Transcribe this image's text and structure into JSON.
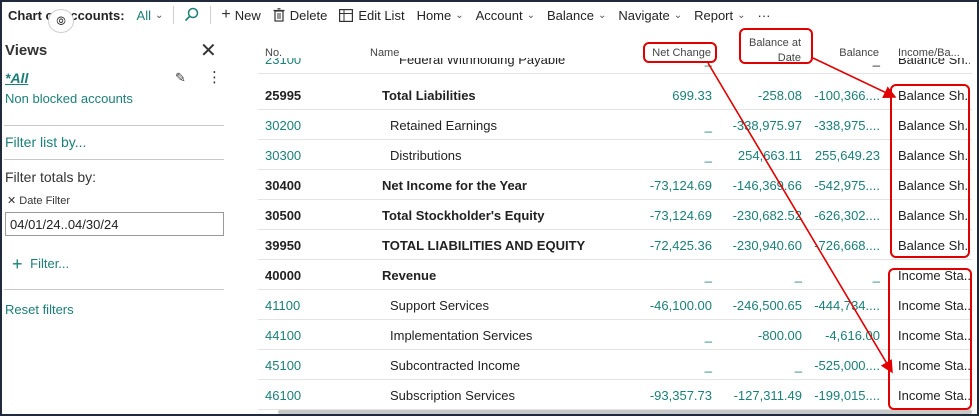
{
  "toolbar": {
    "title": "Chart of Accounts:",
    "filter": "All",
    "new": "New",
    "delete": "Delete",
    "edit_list": "Edit List",
    "home": "Home",
    "account": "Account",
    "balance": "Balance",
    "navigate": "Navigate",
    "report": "Report",
    "more": "···"
  },
  "views": {
    "title": "Views",
    "all": "*All",
    "blocked": "Non blocked accounts",
    "filter_list": "Filter list by...",
    "filter_totals": "Filter totals by:",
    "date_filter_label": "Date Filter",
    "date_filter_value": "04/01/24..04/30/24",
    "add_filter": "Filter...",
    "reset": "Reset filters"
  },
  "grid": {
    "columns": {
      "no": "No.",
      "name": "Name",
      "net_change": "Net Change",
      "balance_at_date_1": "Balance at",
      "balance_at_date_2": "Date",
      "balance": "Balance",
      "income_balance": "Income/Ba..."
    },
    "partial_row": {
      "no": "23100",
      "name": "Federal Withholding Payable",
      "net_change": "_",
      "balance_at_date": "",
      "balance": "_",
      "income_balance": "Balance Sh..."
    },
    "rows": [
      {
        "no": "25995",
        "name": "Total Liabilities",
        "net_change": "699.33",
        "balance_at_date": "-258.08",
        "balance": "-100,366....",
        "income_balance": "Balance Sh..."
      },
      {
        "no": "30200",
        "name": "Retained Earnings",
        "net_change": "_",
        "balance_at_date": "-338,975.97",
        "balance": "-338,975....",
        "income_balance": "Balance Sh..."
      },
      {
        "no": "30300",
        "name": "Distributions",
        "net_change": "_",
        "balance_at_date": "254,663.11",
        "balance": "255,649.23",
        "income_balance": "Balance Sh..."
      },
      {
        "no": "30400",
        "name": "Net Income for the Year",
        "net_change": "-73,124.69",
        "balance_at_date": "-146,369.66",
        "balance": "-542,975....",
        "income_balance": "Balance Sh..."
      },
      {
        "no": "30500",
        "name": "Total Stockholder's Equity",
        "net_change": "-73,124.69",
        "balance_at_date": "-230,682.52",
        "balance": "-626,302....",
        "income_balance": "Balance Sh..."
      },
      {
        "no": "39950",
        "name": "TOTAL LIABILITIES AND EQUITY",
        "net_change": "-72,425.36",
        "balance_at_date": "-230,940.60",
        "balance": "-726,668....",
        "income_balance": "Balance Sh..."
      },
      {
        "no": "40000",
        "name": "Revenue",
        "net_change": "_",
        "balance_at_date": "_",
        "balance": "_",
        "income_balance": "Income Sta..."
      },
      {
        "no": "41100",
        "name": "Support Services",
        "net_change": "-46,100.00",
        "balance_at_date": "-246,500.65",
        "balance": "-444,734....",
        "income_balance": "Income Sta..."
      },
      {
        "no": "44100",
        "name": "Implementation Services",
        "net_change": "_",
        "balance_at_date": "-800.00",
        "balance": "-4,616.00",
        "income_balance": "Income Sta..."
      },
      {
        "no": "45100",
        "name": "Subcontracted Income",
        "net_change": "_",
        "balance_at_date": "_",
        "balance": "-525,000....",
        "income_balance": "Income Sta..."
      },
      {
        "no": "46100",
        "name": "Subscription Services",
        "net_change": "-93,357.73",
        "balance_at_date": "-127,311.49",
        "balance": "-199,015....",
        "income_balance": "Income Sta..."
      }
    ]
  },
  "colors": {
    "accent": "#1b7f79",
    "annotation": "#e00000"
  },
  "icons": [
    "copilot-icon",
    "search-icon",
    "plus-icon",
    "trash-icon",
    "edit-list-icon",
    "close-icon",
    "edit-view-icon",
    "more-icon"
  ]
}
